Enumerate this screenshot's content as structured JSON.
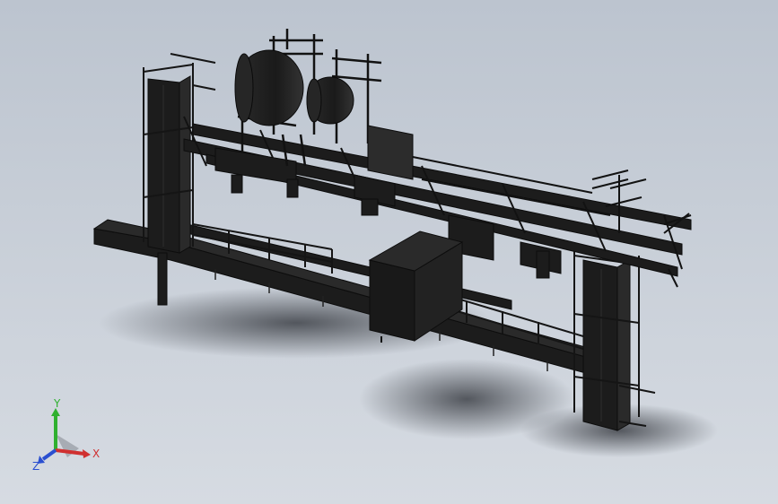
{
  "viewport": {
    "background_top": "#bcc4cf",
    "background_bottom": "#d6dbe2",
    "model_color": "#1c1c1c"
  },
  "triad": {
    "y_label": "Y",
    "x_label": "X",
    "z_label": "Z",
    "y_color": "#2fb02f",
    "x_color": "#d03030",
    "z_color": "#2a4fd0"
  }
}
